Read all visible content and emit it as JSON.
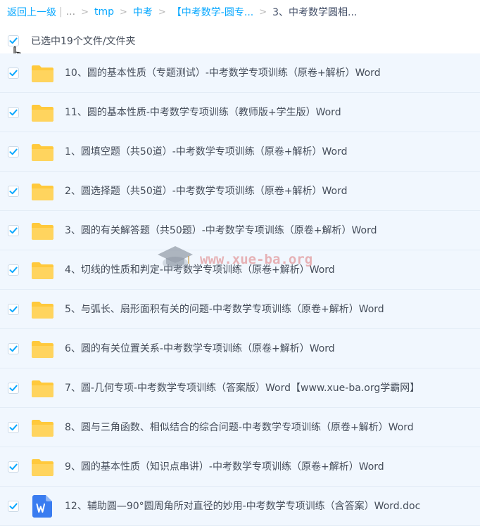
{
  "breadcrumb": {
    "back": "返回上一级",
    "separator": "|",
    "ellipsis": "...",
    "arrow": ">",
    "crumbs": [
      "tmp",
      "中考",
      "【中考数学-圆专..."
    ],
    "current": "3、中考数学圆相..."
  },
  "selection": {
    "label": "已选中19个文件/文件夹",
    "checked": true
  },
  "colors": {
    "accent": "#06a7ff",
    "row_selected_bg": "#f1f7fe",
    "folder": "#ffc93c",
    "word": "#3a7cf0"
  },
  "watermark": {
    "text": "www.xue-ba.org"
  },
  "files": [
    {
      "name": "10、圆的基本性质（专题测试）-中考数学专项训练（原卷+解析）Word",
      "type": "folder",
      "icon": "folder-icon",
      "checked": true
    },
    {
      "name": "11、圆的基本性质-中考数学专项训练（教师版+学生版）Word",
      "type": "folder",
      "icon": "folder-icon",
      "checked": true
    },
    {
      "name": "1、圆填空题（共50道）-中考数学专项训练（原卷+解析）Word",
      "type": "folder",
      "icon": "folder-icon",
      "checked": true
    },
    {
      "name": "2、圆选择题（共50道）-中考数学专项训练（原卷+解析）Word",
      "type": "folder",
      "icon": "folder-icon",
      "checked": true
    },
    {
      "name": "3、圆的有关解答题（共50题）-中考数学专项训练（原卷+解析）Word",
      "type": "folder",
      "icon": "folder-icon",
      "checked": true
    },
    {
      "name": "4、切线的性质和判定-中考数学专项训练（原卷+解析）Word",
      "type": "folder",
      "icon": "folder-icon",
      "checked": true
    },
    {
      "name": "5、与弧长、扇形面积有关的问题-中考数学专项训练（原卷+解析）Word",
      "type": "folder",
      "icon": "folder-icon",
      "checked": true
    },
    {
      "name": "6、圆的有关位置关系-中考数学专项训练（原卷+解析）Word",
      "type": "folder",
      "icon": "folder-icon",
      "checked": true
    },
    {
      "name": "7、圆-几何专项-中考数学专项训练（答案版）Word【www.xue-ba.org学霸网】",
      "type": "folder",
      "icon": "folder-icon",
      "checked": true
    },
    {
      "name": "8、圆与三角函数、相似结合的综合问题-中考数学专项训练（原卷+解析）Word",
      "type": "folder",
      "icon": "folder-icon",
      "checked": true
    },
    {
      "name": "9、圆的基本性质（知识点串讲）-中考数学专项训练（原卷+解析）Word",
      "type": "folder",
      "icon": "folder-icon",
      "checked": true
    },
    {
      "name": "12、辅助圆—90°圆周角所对直径的妙用-中考数学专项训练（含答案）Word.doc",
      "type": "word",
      "icon": "word-doc-icon",
      "checked": true
    }
  ]
}
